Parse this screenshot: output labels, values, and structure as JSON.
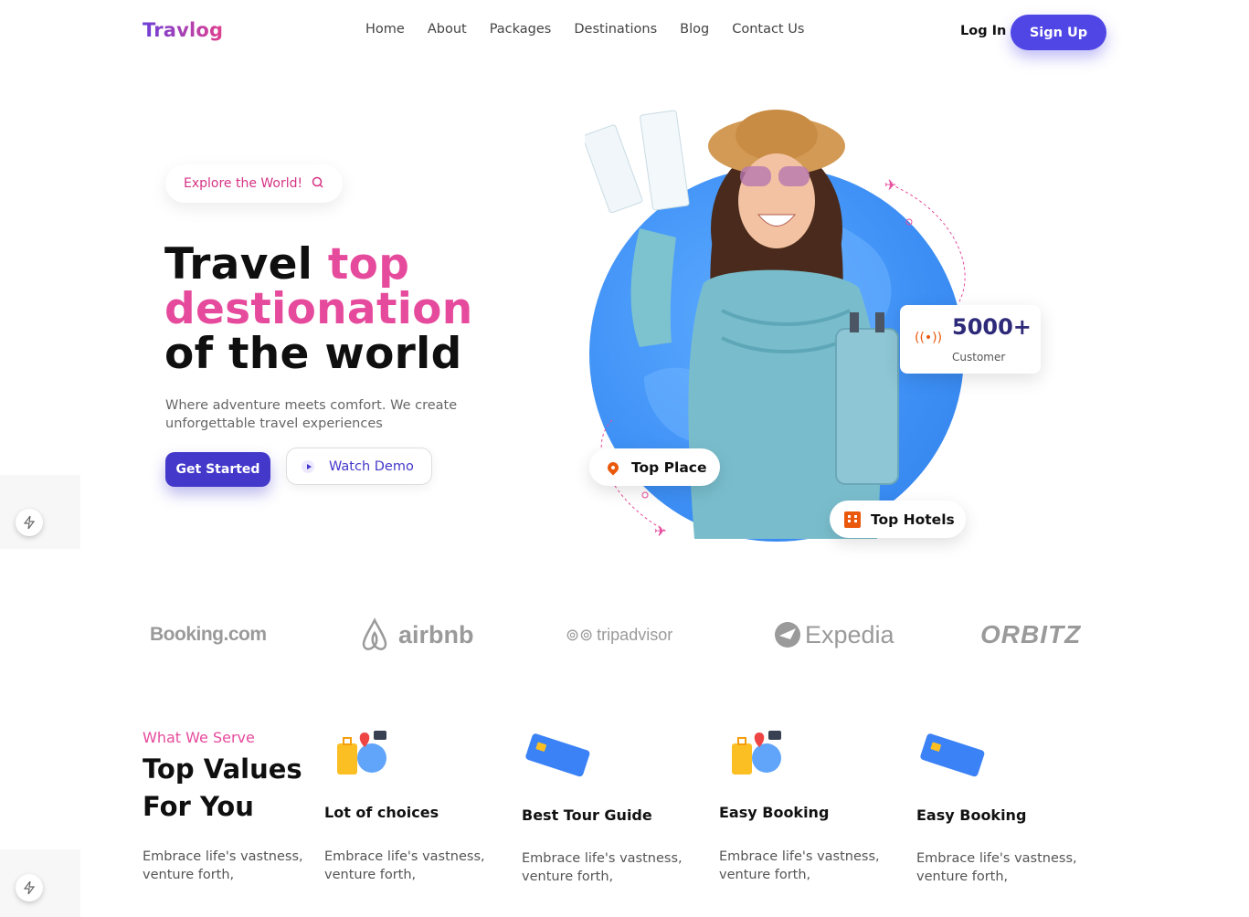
{
  "brand": {
    "logo": "Travlog"
  },
  "nav": {
    "items": [
      "Home",
      "About",
      "Packages",
      "Destinations",
      "Blog",
      "Contact Us"
    ]
  },
  "auth": {
    "login": "Log In",
    "signup": "Sign Up"
  },
  "hero": {
    "pill": "Explore the World!",
    "title_line1_a": "Travel ",
    "title_line1_b": "top",
    "title_line2": "destionation",
    "title_line3": "of the world",
    "subtitle": "Where adventure meets comfort. We create unforgettable travel experiences",
    "cta_primary": "Get Started",
    "cta_secondary": "Watch Demo",
    "stat_value": "5000+",
    "stat_label": "Customer",
    "badge_place": "Top Place",
    "badge_hotels": "Top Hotels"
  },
  "partners": [
    "Booking.com",
    "airbnb",
    "tripadvisor",
    "Expedia",
    "ORBITZ"
  ],
  "serve": {
    "eyebrow": "What We Serve",
    "title_line1": "Top Values",
    "title_line2": "For You",
    "description": "Embrace life's vastness, venture forth,",
    "features": [
      {
        "title": "Lot of choices",
        "description": "Embrace life's vastness, venture forth,",
        "icon": "luggage-map-icon"
      },
      {
        "title": "Best Tour Guide",
        "description": "Embrace life's vastness, venture forth,",
        "icon": "credit-card-icon"
      },
      {
        "title": "Easy Booking",
        "description": "Embrace life's vastness, venture forth,",
        "icon": "luggage-map-icon"
      },
      {
        "title": "Easy Booking",
        "description": "Embrace life's vastness, venture forth,",
        "icon": "credit-card-icon"
      }
    ]
  },
  "colors": {
    "primary": "#4f46e5",
    "accent": "#e64a9c",
    "globe": "#3d8ff5",
    "orange": "#ea580c"
  }
}
